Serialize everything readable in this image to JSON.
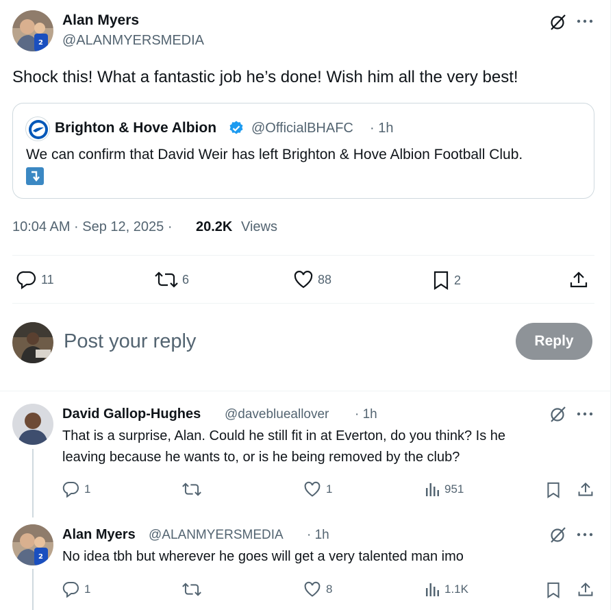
{
  "main_tweet": {
    "author_name": "Alan Myers",
    "author_handle": "@ALANMYERSMEDIA",
    "text": "Shock this! What a fantastic job he’s done! Wish him all the very best!",
    "quote": {
      "author_name": "Brighton & Hove Albion",
      "author_handle": "@OfficialBHAFC",
      "time": "· 1h",
      "text": "We can confirm that David Weir has left Brighton & Hove Albion Football Club."
    },
    "timestamp": "10:04 AM · Sep 12, 2025 ·",
    "views_count": "20.2K",
    "views_label": "Views",
    "stats": {
      "replies": "11",
      "reposts": "6",
      "likes": "88",
      "bookmarks": "2"
    }
  },
  "composer": {
    "placeholder": "Post your reply",
    "reply_label": "Reply"
  },
  "replies": [
    {
      "author_name": "David Gallop-Hughes",
      "author_handle": "@daveblueallover",
      "time": "· 1h",
      "line1": "That is a surprise, Alan. Could he still fit in at Everton, do you think? Is he",
      "line2": "leaving because he wants to, or is he being removed by the club?",
      "stats": {
        "replies": "1",
        "reposts": "",
        "likes": "1",
        "views": "951"
      }
    },
    {
      "author_name": "Alan Myers",
      "author_handle": "@ALANMYERSMEDIA",
      "time": "· 1h",
      "line1": "No idea tbh but wherever he goes will get a very talented man imo",
      "stats": {
        "replies": "1",
        "reposts": "",
        "likes": "8",
        "views": "1.1K"
      }
    }
  ],
  "icons": [
    "grok-icon",
    "more-icon",
    "reply-icon",
    "repost-icon",
    "like-icon",
    "bookmark-icon",
    "share-icon",
    "views-icon",
    "verified-badge-icon",
    "arrow-down-icon"
  ],
  "colors": {
    "accent": "#1d9bf0",
    "grey_text": "#536471",
    "reply_button_disabled": "#8e9398"
  }
}
